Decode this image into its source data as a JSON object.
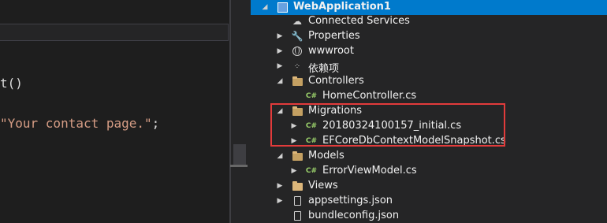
{
  "editor": {
    "line1": "t()",
    "line2_string": "\"Your contact page.\"",
    "line2_tail": ";"
  },
  "explorer": {
    "items": [
      {
        "label": "WebApplication1",
        "icon": "project-icon",
        "expander": "◢"
      },
      {
        "label": "Connected Services",
        "icon": "cloud-icon",
        "expander": ""
      },
      {
        "label": "Properties",
        "icon": "wrench-icon",
        "expander": "▶"
      },
      {
        "label": "wwwroot",
        "icon": "globe-icon",
        "expander": "▶"
      },
      {
        "label": "依赖项",
        "icon": "dependencies-icon",
        "expander": "▶"
      },
      {
        "label": "Controllers",
        "icon": "folder-open-icon",
        "expander": "◢"
      },
      {
        "label": "HomeController.cs",
        "icon": "csharp-file-icon",
        "expander": ""
      },
      {
        "label": "Migrations",
        "icon": "folder-open-icon",
        "expander": "◢"
      },
      {
        "label": "20180324100157_initial.cs",
        "icon": "csharp-file-icon",
        "expander": "▶"
      },
      {
        "label": "EFCoreDbContextModelSnapshot.cs",
        "icon": "csharp-file-icon",
        "expander": "▶"
      },
      {
        "label": "Models",
        "icon": "folder-open-icon",
        "expander": "◢"
      },
      {
        "label": "ErrorViewModel.cs",
        "icon": "csharp-file-icon",
        "expander": "▶"
      },
      {
        "label": "Views",
        "icon": "folder-icon",
        "expander": "▶"
      },
      {
        "label": "appsettings.json",
        "icon": "json-file-icon",
        "expander": "▶"
      },
      {
        "label": "bundleconfig.json",
        "icon": "json-file-icon",
        "expander": ""
      }
    ],
    "cs_glyph": "C#"
  },
  "colors": {
    "selection": "#007acc",
    "annotation_box": "#e23b3b",
    "folder": "#dcb67a"
  }
}
